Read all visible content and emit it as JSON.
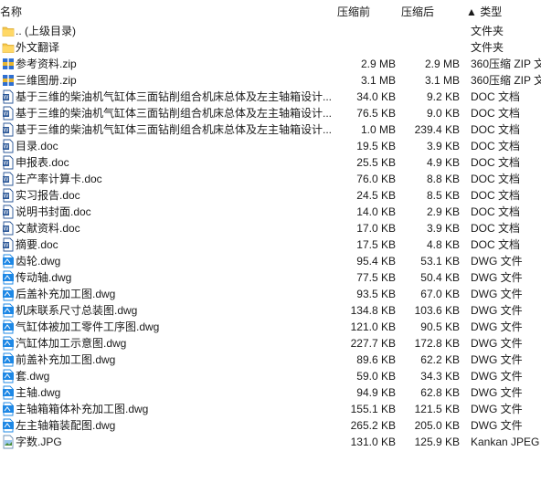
{
  "columns": {
    "name": "名称",
    "compressed": "压缩前",
    "original": "压缩后",
    "type": "▲ 类型"
  },
  "files": [
    {
      "icon": "folder-icon",
      "name": ".. (上级目录)",
      "size": "",
      "packed": "",
      "type": "文件夹"
    },
    {
      "icon": "folder-icon",
      "name": "外文翻译",
      "size": "",
      "packed": "",
      "type": "文件夹"
    },
    {
      "icon": "zip-icon",
      "name": "参考资料.zip",
      "size": "2.9 MB",
      "packed": "2.9 MB",
      "type": "360压缩 ZIP 文"
    },
    {
      "icon": "zip-icon",
      "name": "三维图册.zip",
      "size": "3.1 MB",
      "packed": "3.1 MB",
      "type": "360压缩 ZIP 文"
    },
    {
      "icon": "doc-icon",
      "name": "基于三维的柴油机气缸体三面钻削组合机床总体及左主轴箱设计...",
      "size": "34.0 KB",
      "packed": "9.2 KB",
      "type": "DOC 文档"
    },
    {
      "icon": "doc-icon",
      "name": "基于三维的柴油机气缸体三面钻削组合机床总体及左主轴箱设计...",
      "size": "76.5 KB",
      "packed": "9.0 KB",
      "type": "DOC 文档"
    },
    {
      "icon": "doc-icon",
      "name": "基于三维的柴油机气缸体三面钻削组合机床总体及左主轴箱设计...",
      "size": "1.0 MB",
      "packed": "239.4 KB",
      "type": "DOC 文档"
    },
    {
      "icon": "doc-icon",
      "name": "目录.doc",
      "size": "19.5 KB",
      "packed": "3.9 KB",
      "type": "DOC 文档"
    },
    {
      "icon": "doc-icon",
      "name": "申报表.doc",
      "size": "25.5 KB",
      "packed": "4.9 KB",
      "type": "DOC 文档"
    },
    {
      "icon": "doc-icon",
      "name": "生产率计算卡.doc",
      "size": "76.0 KB",
      "packed": "8.8 KB",
      "type": "DOC 文档"
    },
    {
      "icon": "doc-icon",
      "name": "实习报告.doc",
      "size": "24.5 KB",
      "packed": "8.5 KB",
      "type": "DOC 文档"
    },
    {
      "icon": "doc-icon",
      "name": "说明书封面.doc",
      "size": "14.0 KB",
      "packed": "2.9 KB",
      "type": "DOC 文档"
    },
    {
      "icon": "doc-icon",
      "name": "文献资料.doc",
      "size": "17.0 KB",
      "packed": "3.9 KB",
      "type": "DOC 文档"
    },
    {
      "icon": "doc-icon",
      "name": "摘要.doc",
      "size": "17.5 KB",
      "packed": "4.8 KB",
      "type": "DOC 文档"
    },
    {
      "icon": "dwg-icon",
      "name": "齿轮.dwg",
      "size": "95.4 KB",
      "packed": "53.1 KB",
      "type": "DWG 文件"
    },
    {
      "icon": "dwg-icon",
      "name": "传动轴.dwg",
      "size": "77.5 KB",
      "packed": "50.4 KB",
      "type": "DWG 文件"
    },
    {
      "icon": "dwg-icon",
      "name": "后盖补充加工图.dwg",
      "size": "93.5 KB",
      "packed": "67.0 KB",
      "type": "DWG 文件"
    },
    {
      "icon": "dwg-icon",
      "name": "机床联系尺寸总装图.dwg",
      "size": "134.8 KB",
      "packed": "103.6 KB",
      "type": "DWG 文件"
    },
    {
      "icon": "dwg-icon",
      "name": "气缸体被加工零件工序图.dwg",
      "size": "121.0 KB",
      "packed": "90.5 KB",
      "type": "DWG 文件"
    },
    {
      "icon": "dwg-icon",
      "name": "汽缸体加工示意图.dwg",
      "size": "227.7 KB",
      "packed": "172.8 KB",
      "type": "DWG 文件"
    },
    {
      "icon": "dwg-icon",
      "name": "前盖补充加工图.dwg",
      "size": "89.6 KB",
      "packed": "62.2 KB",
      "type": "DWG 文件"
    },
    {
      "icon": "dwg-icon",
      "name": "套.dwg",
      "size": "59.0 KB",
      "packed": "34.3 KB",
      "type": "DWG 文件"
    },
    {
      "icon": "dwg-icon",
      "name": "主轴.dwg",
      "size": "94.9 KB",
      "packed": "62.8 KB",
      "type": "DWG 文件"
    },
    {
      "icon": "dwg-icon",
      "name": "主轴箱箱体补充加工图.dwg",
      "size": "155.1 KB",
      "packed": "121.5 KB",
      "type": "DWG 文件"
    },
    {
      "icon": "dwg-icon",
      "name": "左主轴箱装配图.dwg",
      "size": "265.2 KB",
      "packed": "205.0 KB",
      "type": "DWG 文件"
    },
    {
      "icon": "jpg-icon",
      "name": "字数.JPG",
      "size": "131.0 KB",
      "packed": "125.9 KB",
      "type": "Kankan JPEG"
    }
  ],
  "colors": {
    "folder": "#f5c74a",
    "doc": "#2b5797",
    "dwg": "#1e88e5",
    "zip_blue": "#2f6fd1",
    "zip_gold": "#e8b630"
  }
}
